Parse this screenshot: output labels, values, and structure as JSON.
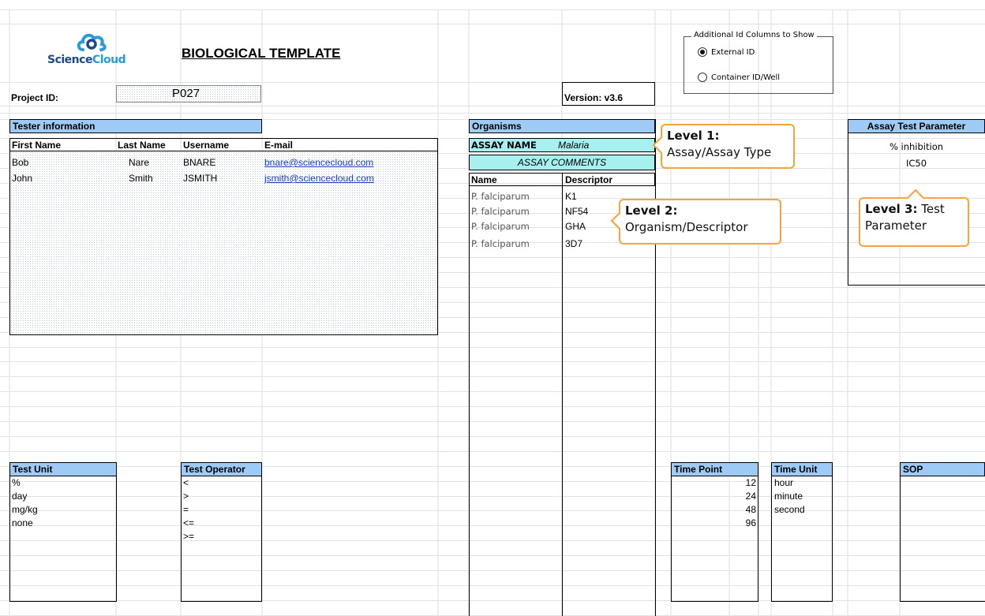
{
  "title": "BIOLOGICAL TEMPLATE",
  "logo": {
    "icon": "cloud-icon",
    "text_science": "Science",
    "text_cloud": "Cloud",
    "color_dark": "#1e4a8c",
    "color_light": "#2a9ad8"
  },
  "project": {
    "label": "Project ID:",
    "value": "P027"
  },
  "version": {
    "label": "Version: v3.6"
  },
  "id_columns": {
    "legend": "Additional Id Columns to Show",
    "options": [
      {
        "label": "External ID",
        "selected": true
      },
      {
        "label": "Container ID/Well",
        "selected": false
      }
    ]
  },
  "tester": {
    "header": "Tester information",
    "columns": [
      "First Name",
      "Last Name",
      "Username",
      "E-mail"
    ],
    "rows": [
      [
        "Bob",
        "Nare",
        "BNARE",
        "bnare@sciencecloud.com"
      ],
      [
        "John",
        "Smith",
        "JSMITH",
        "jsmith@sciencecloud.com"
      ]
    ]
  },
  "organisms": {
    "header": "Organisms",
    "assay_name_label": "ASSAY NAME",
    "assay_name_value": "Malaria",
    "assay_comments": "ASSAY COMMENTS",
    "columns": [
      "Name",
      "Descriptor"
    ],
    "rows": [
      [
        "P. falciparum",
        "K1"
      ],
      [
        "P. falciparum",
        "NF54"
      ],
      [
        "P. falciparum",
        "GHA"
      ],
      [
        "P. falciparum",
        "3D7"
      ]
    ]
  },
  "assay_param": {
    "header": "Assay Test Parameter",
    "items": [
      "% inhibition",
      "IC50"
    ]
  },
  "callouts": {
    "level1": {
      "bold": "Level 1:",
      "text": "Assay/Assay Type"
    },
    "level2": {
      "bold": "Level 2:",
      "text": "Organism/Descriptor"
    },
    "level3": {
      "bold": "Level 3:",
      "text1": " Test",
      "text2": "Parameter"
    }
  },
  "test_unit": {
    "header": "Test Unit",
    "items": [
      "%",
      "day",
      "mg/kg",
      "none"
    ]
  },
  "test_operator": {
    "header": "Test Operator",
    "items": [
      "<",
      ">",
      "=",
      "<=",
      ">="
    ]
  },
  "time_point": {
    "header": "Time Point",
    "items": [
      "12",
      "24",
      "48",
      "96"
    ]
  },
  "time_unit": {
    "header": "Time Unit",
    "items": [
      "hour",
      "minute",
      "second"
    ]
  },
  "sop": {
    "header": "SOP"
  },
  "colors": {
    "header_blue": "#9ecbf5",
    "cyan": "#a6f0f0",
    "callout_orange": "#f6a33a",
    "link": "#1a3ec9"
  }
}
